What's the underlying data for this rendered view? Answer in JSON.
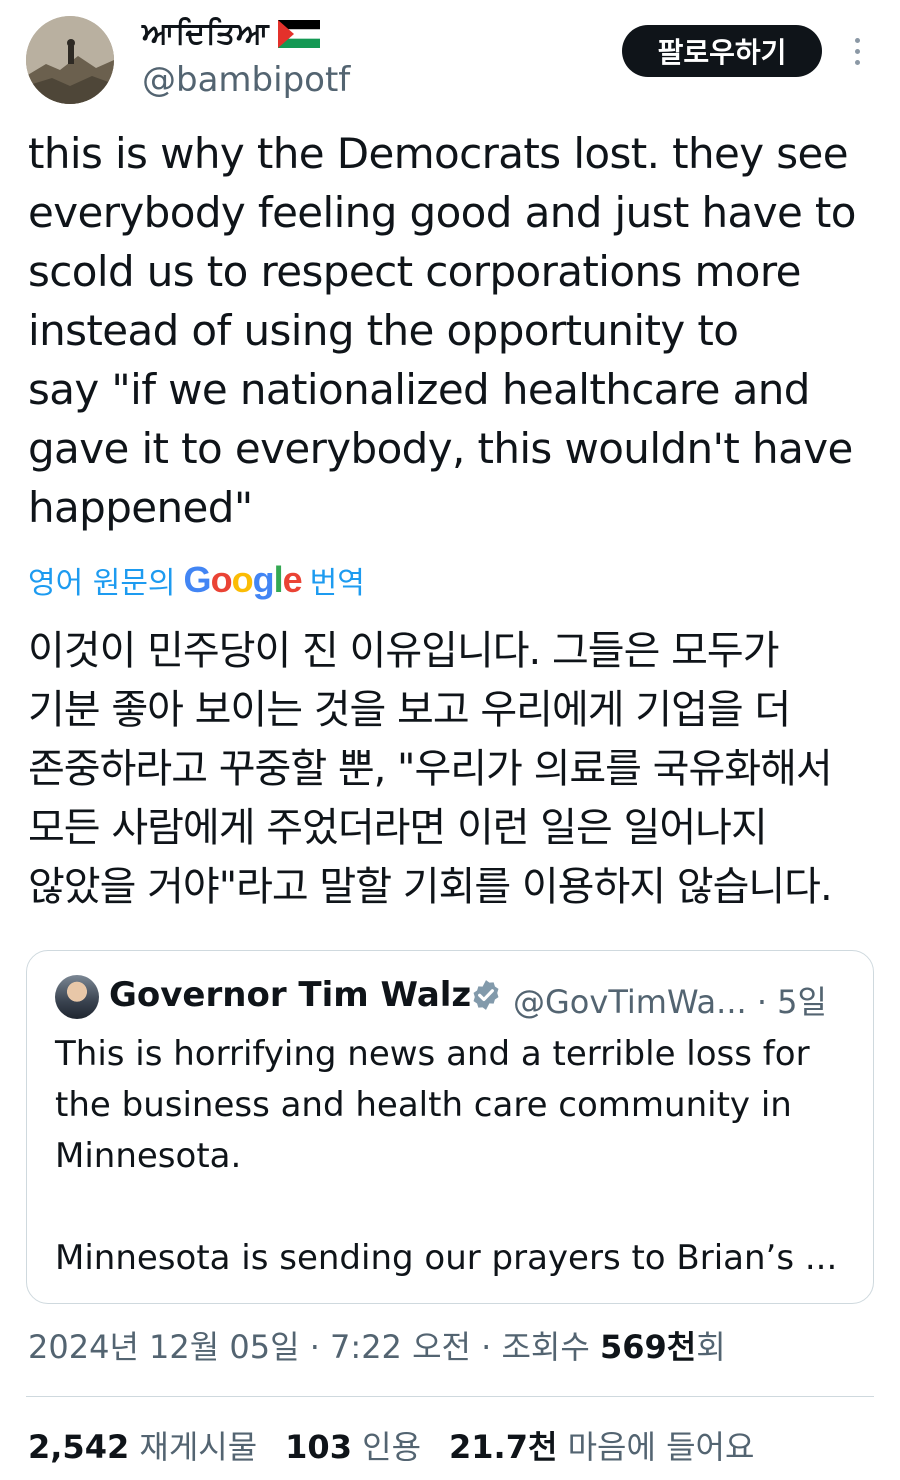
{
  "author": {
    "display_name": "ਆਦਿਤਿਆ",
    "handle": "@bambipotf"
  },
  "follow_label": "팔로우하기",
  "tweet": {
    "text": "this is why the Democrats lost. they see\neverybody feeling good and just have to\nscold us to respect corporations more\ninstead of using the opportunity to\nsay \"if we nationalized healthcare and\ngave it to everybody, this wouldn't have\nhappened\"",
    "translate_prefix": "영어 원문의",
    "translate_brand": "Google",
    "translate_suffix": "번역",
    "translated_text": "이것이 민주당이 진 이유입니다. 그들은 모두가\n기분 좋아 보이는 것을 보고 우리에게 기업을 더\n존중하라고 꾸중할 뿐, \"우리가 의료를 국유화해서\n모든 사람에게 주었더라면 이런 일은 일어나지\n않았을 거야\"라고 말할 기회를 이용하지 않습니다."
  },
  "quote": {
    "display_name": "Governor Tim Walz",
    "handle_time": "@GovTimWa... · 5일",
    "text": "This is horrifying news and a terrible loss for\nthe business and health care community in\nMinnesota.\n\nMinnesota is sending our prayers to Brian’s ..."
  },
  "meta": {
    "datetime": "2024년 12월 05일 · 7:22 오전 · 조회수",
    "views": "569천",
    "views_suffix": "회"
  },
  "stats": {
    "retweets": "2,542",
    "retweets_label": "재게시물",
    "quotes": "103",
    "quotes_label": "인용",
    "likes": "21.7천",
    "likes_label": "마음에 들어요"
  }
}
